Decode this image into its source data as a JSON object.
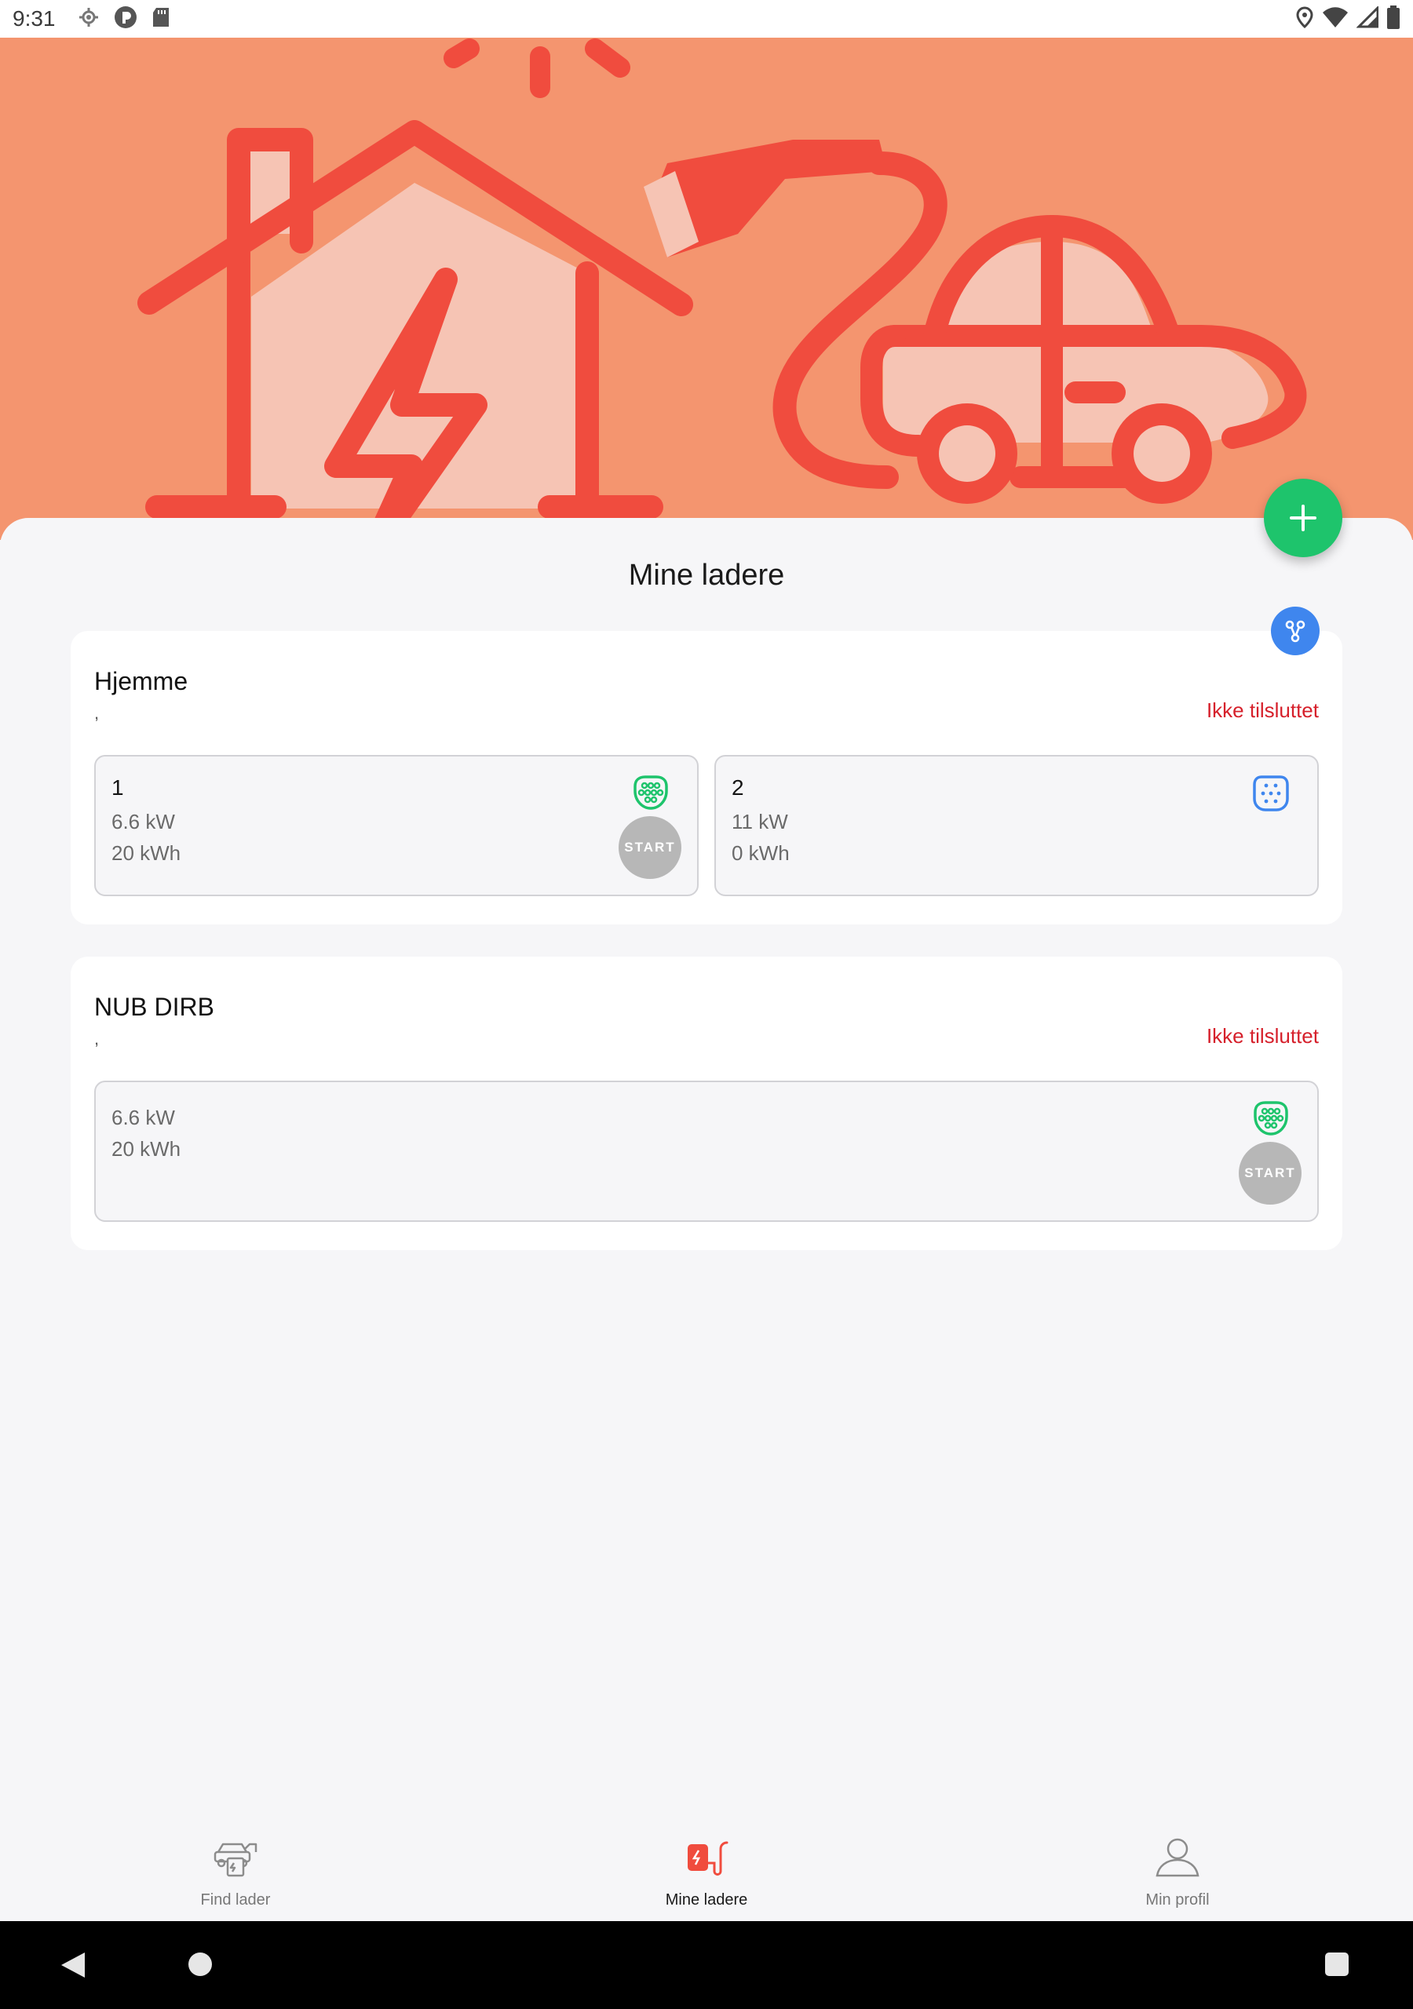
{
  "status_bar": {
    "time": "9:31"
  },
  "hero": {
    "icon": "home-charging-illustration"
  },
  "page": {
    "title": "Mine ladere"
  },
  "colors": {
    "accent_red": "#f04c3e",
    "hero_bg": "#f4956f",
    "fab_green": "#1ec46c",
    "share_blue": "#3f86ee",
    "status_red": "#d6202b"
  },
  "chargers": [
    {
      "name": "Hjemme",
      "subtitle": ",",
      "status": "Ikke tilsluttet",
      "connectors": [
        {
          "name": "1",
          "power": "6.6 kW",
          "energy": "20 kWh",
          "icon": "type2-plug-icon",
          "start": "START"
        },
        {
          "name": "2",
          "power": "11 kW",
          "energy": "0 kWh",
          "icon": "type2-socket-icon"
        }
      ]
    },
    {
      "name": "NUB DIRB",
      "subtitle": ",",
      "status": "Ikke tilsluttet",
      "connectors": [
        {
          "power": "6.6 kW",
          "energy": "20 kWh",
          "icon": "type2-plug-icon",
          "start": "START"
        }
      ]
    }
  ],
  "nav": {
    "items": [
      {
        "label": "Find lader",
        "icon": "find-charger-icon"
      },
      {
        "label": "Mine ladere",
        "icon": "my-chargers-icon"
      },
      {
        "label": "Min profil",
        "icon": "profile-icon"
      }
    ]
  }
}
